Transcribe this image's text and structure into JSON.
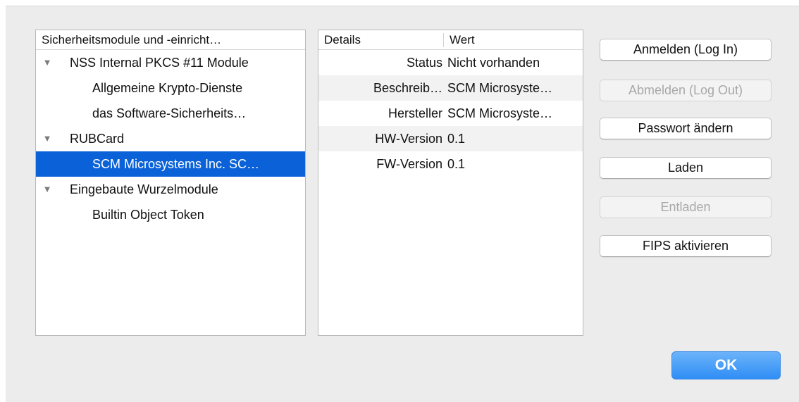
{
  "modules": {
    "header": "Sicherheitsmodule und -einricht…",
    "items": [
      {
        "label": "NSS Internal PKCS #11 Module",
        "level": 0,
        "expanded": true
      },
      {
        "label": "Allgemeine Krypto-Dienste",
        "level": 1
      },
      {
        "label": "das Software-Sicherheits…",
        "level": 1
      },
      {
        "label": "RUBCard",
        "level": 0,
        "expanded": true
      },
      {
        "label": "SCM Microsystems Inc. SC…",
        "level": 1,
        "selected": true
      },
      {
        "label": "Eingebaute Wurzelmodule",
        "level": 0,
        "expanded": true
      },
      {
        "label": "Builtin Object Token",
        "level": 1
      }
    ],
    "disclosure_icon": "▼"
  },
  "details": {
    "header_details": "Details",
    "header_value": "Wert",
    "rows": [
      {
        "key": "Status",
        "value": "Nicht vorhanden"
      },
      {
        "key": "Beschreib…",
        "value": "SCM Microsyste…"
      },
      {
        "key": "Hersteller",
        "value": "SCM Microsyste…"
      },
      {
        "key": "HW-Version",
        "value": "0.1"
      },
      {
        "key": "FW-Version",
        "value": "0.1"
      }
    ]
  },
  "buttons": {
    "login": "Anmelden (Log In)",
    "logout": "Abmelden (Log Out)",
    "change_password": "Passwort ändern",
    "load": "Laden",
    "unload": "Entladen",
    "fips": "FIPS aktivieren",
    "ok": "OK"
  },
  "colors": {
    "selection": "#0b62d8",
    "ok_button": "#2f8ef5",
    "background": "#ececec"
  }
}
